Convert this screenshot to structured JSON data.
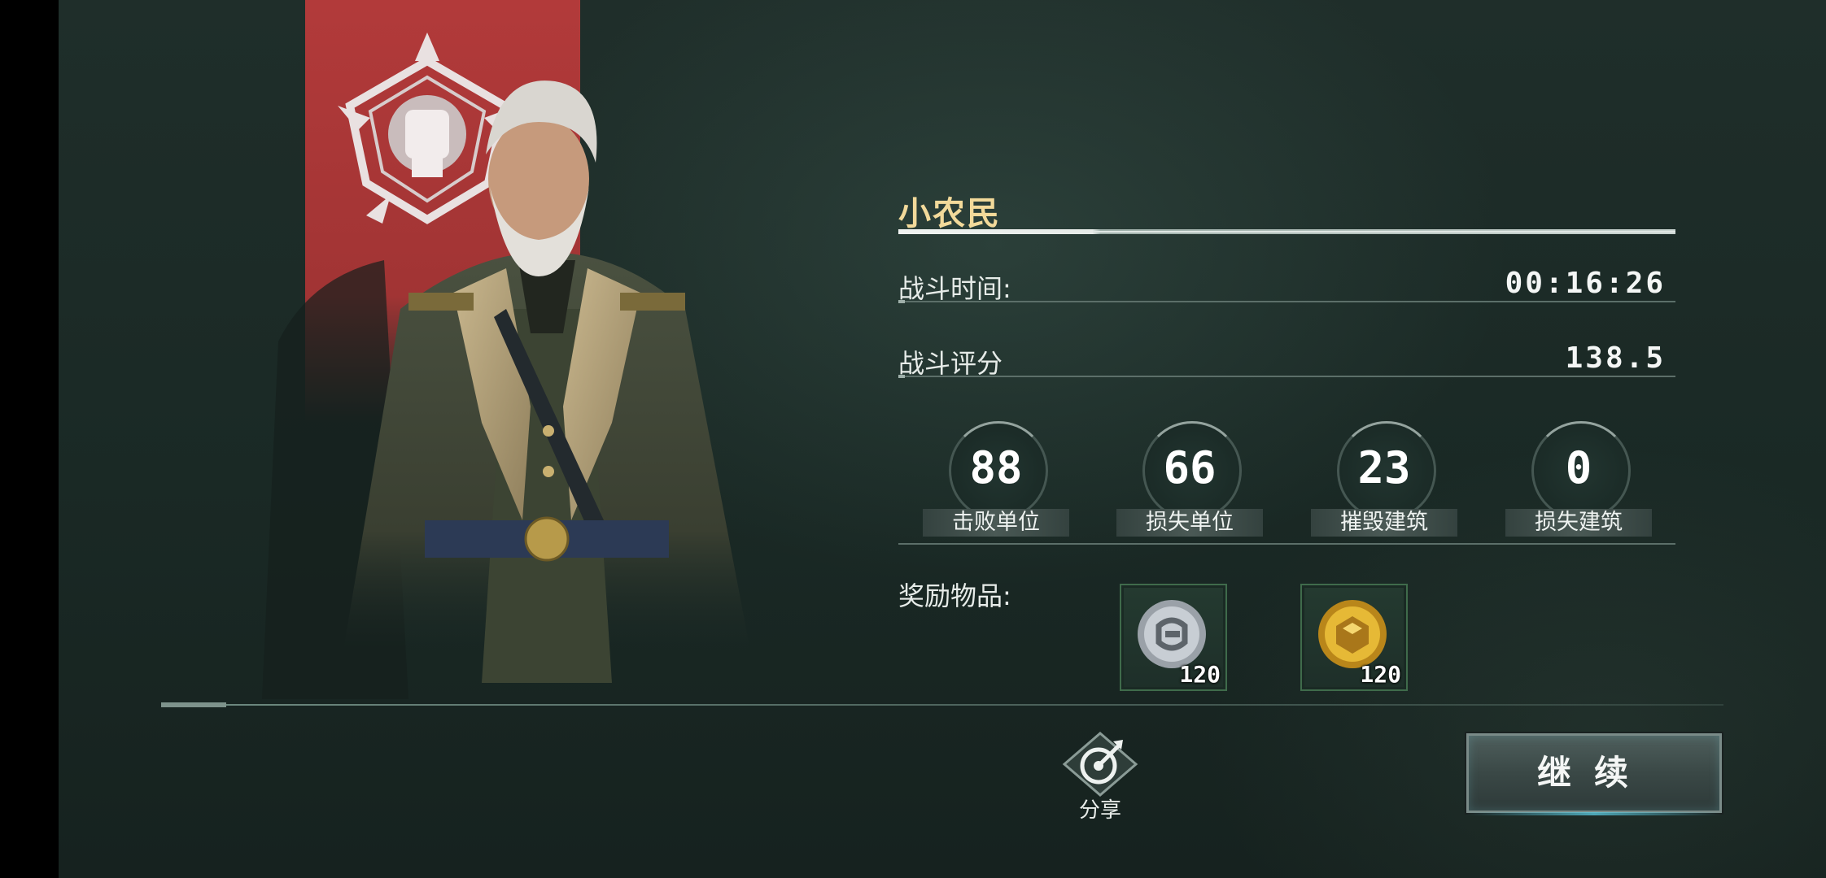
{
  "player": {
    "name": "小农民"
  },
  "stats": {
    "battle_time_label": "战斗时间:",
    "battle_time_value": "00:16:26",
    "battle_score_label": "战斗评分",
    "battle_score_value": "138.5"
  },
  "counters": [
    {
      "value": "88",
      "label": "击败单位"
    },
    {
      "value": "66",
      "label": "损失单位"
    },
    {
      "value": "23",
      "label": "摧毁建筑"
    },
    {
      "value": "0",
      "label": "损失建筑"
    }
  ],
  "rewards": {
    "label": "奖励物品:",
    "items": [
      {
        "icon": "silver-coin-icon",
        "amount": "120",
        "color": "#b8bec4"
      },
      {
        "icon": "gold-coin-icon",
        "amount": "120",
        "color": "#d9a92a"
      }
    ]
  },
  "actions": {
    "share_label": "分享",
    "continue_label": "继续"
  },
  "colors": {
    "banner": "#a13434",
    "name": "#f2d99a",
    "background": "#1c2a26"
  }
}
